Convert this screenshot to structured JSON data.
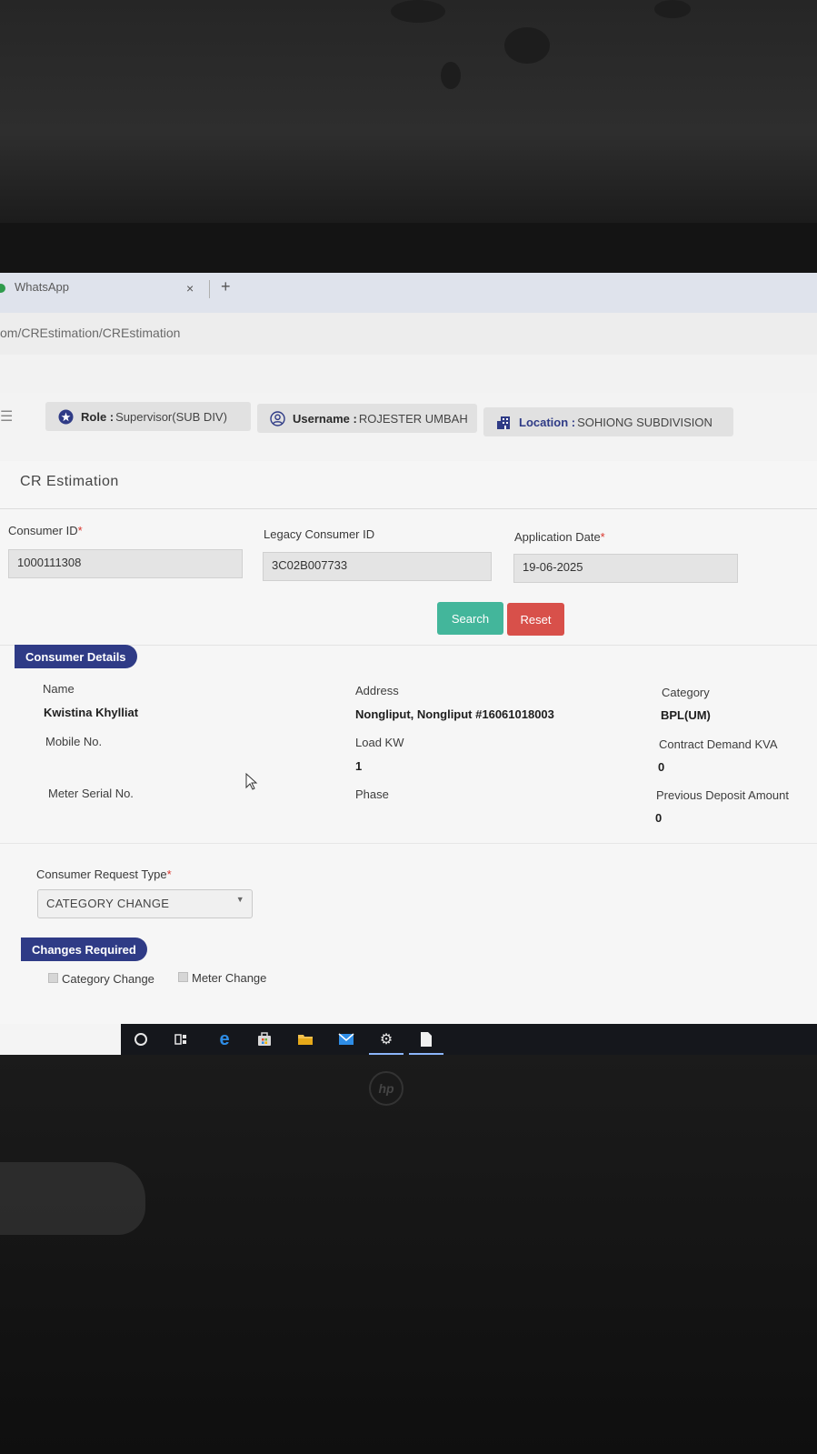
{
  "browser": {
    "tab_title": "WhatsApp",
    "tab_close": "×",
    "new_tab": "+",
    "url": "om/CREstimation/CREstimation"
  },
  "header": {
    "role_label": "Role :",
    "role_value": "Supervisor(SUB DIV)",
    "username_label": "Username :",
    "username_value": "ROJESTER UMBAH",
    "location_label": "Location :",
    "location_value": "SOHIONG SUBDIVISION"
  },
  "page": {
    "title": "CR Estimation"
  },
  "search_form": {
    "consumer_id_label": "Consumer ID",
    "consumer_id_value": "1000111308",
    "legacy_id_label": "Legacy Consumer ID",
    "legacy_id_value": "3C02B007733",
    "application_date_label": "Application Date",
    "application_date_value": "19-06-2025",
    "required_mark": "*",
    "search_label": "Search",
    "reset_label": "Reset"
  },
  "consumer_details": {
    "heading": "Consumer Details",
    "name_label": "Name",
    "name_value": "Kwistina Khylliat",
    "address_label": "Address",
    "address_value": "Nongliput, Nongliput #16061018003",
    "category_label": "Category",
    "category_value": "BPL(UM)",
    "mobile_label": "Mobile No.",
    "load_label": "Load KW",
    "load_value": "1",
    "contract_label": "Contract Demand KVA",
    "contract_value": "0",
    "meter_label": "Meter Serial No.",
    "phase_label": "Phase",
    "deposit_label": "Previous Deposit Amount",
    "deposit_value": "0"
  },
  "request": {
    "type_label": "Consumer Request Type",
    "type_value": "CATEGORY CHANGE"
  },
  "changes": {
    "heading": "Changes Required",
    "category_change_label": "Category Change",
    "meter_change_label": "Meter Change"
  },
  "colors": {
    "accent_navy": "#2f3b86",
    "search_green": "#43b69b",
    "reset_red": "#d8504a",
    "required_red": "#d9342b"
  },
  "icons": {
    "role": "role-badge-icon",
    "username": "user-circle-icon",
    "location": "building-icon"
  },
  "monitor": {
    "brand": "hp"
  }
}
